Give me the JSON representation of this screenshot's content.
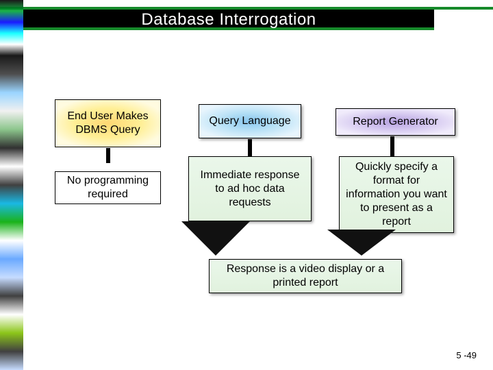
{
  "title": "Database Interrogation",
  "boxes": {
    "end_user": "End User Makes DBMS Query",
    "query_language": "Query Language",
    "report_generator": "Report Generator",
    "no_programming": "No programming required",
    "immediate": "Immediate response to ad hoc data requests",
    "quickly": "Quickly specify a format for information you want to present as a report",
    "response": "Response is a video display or a printed report"
  },
  "page_number": "5 -49"
}
